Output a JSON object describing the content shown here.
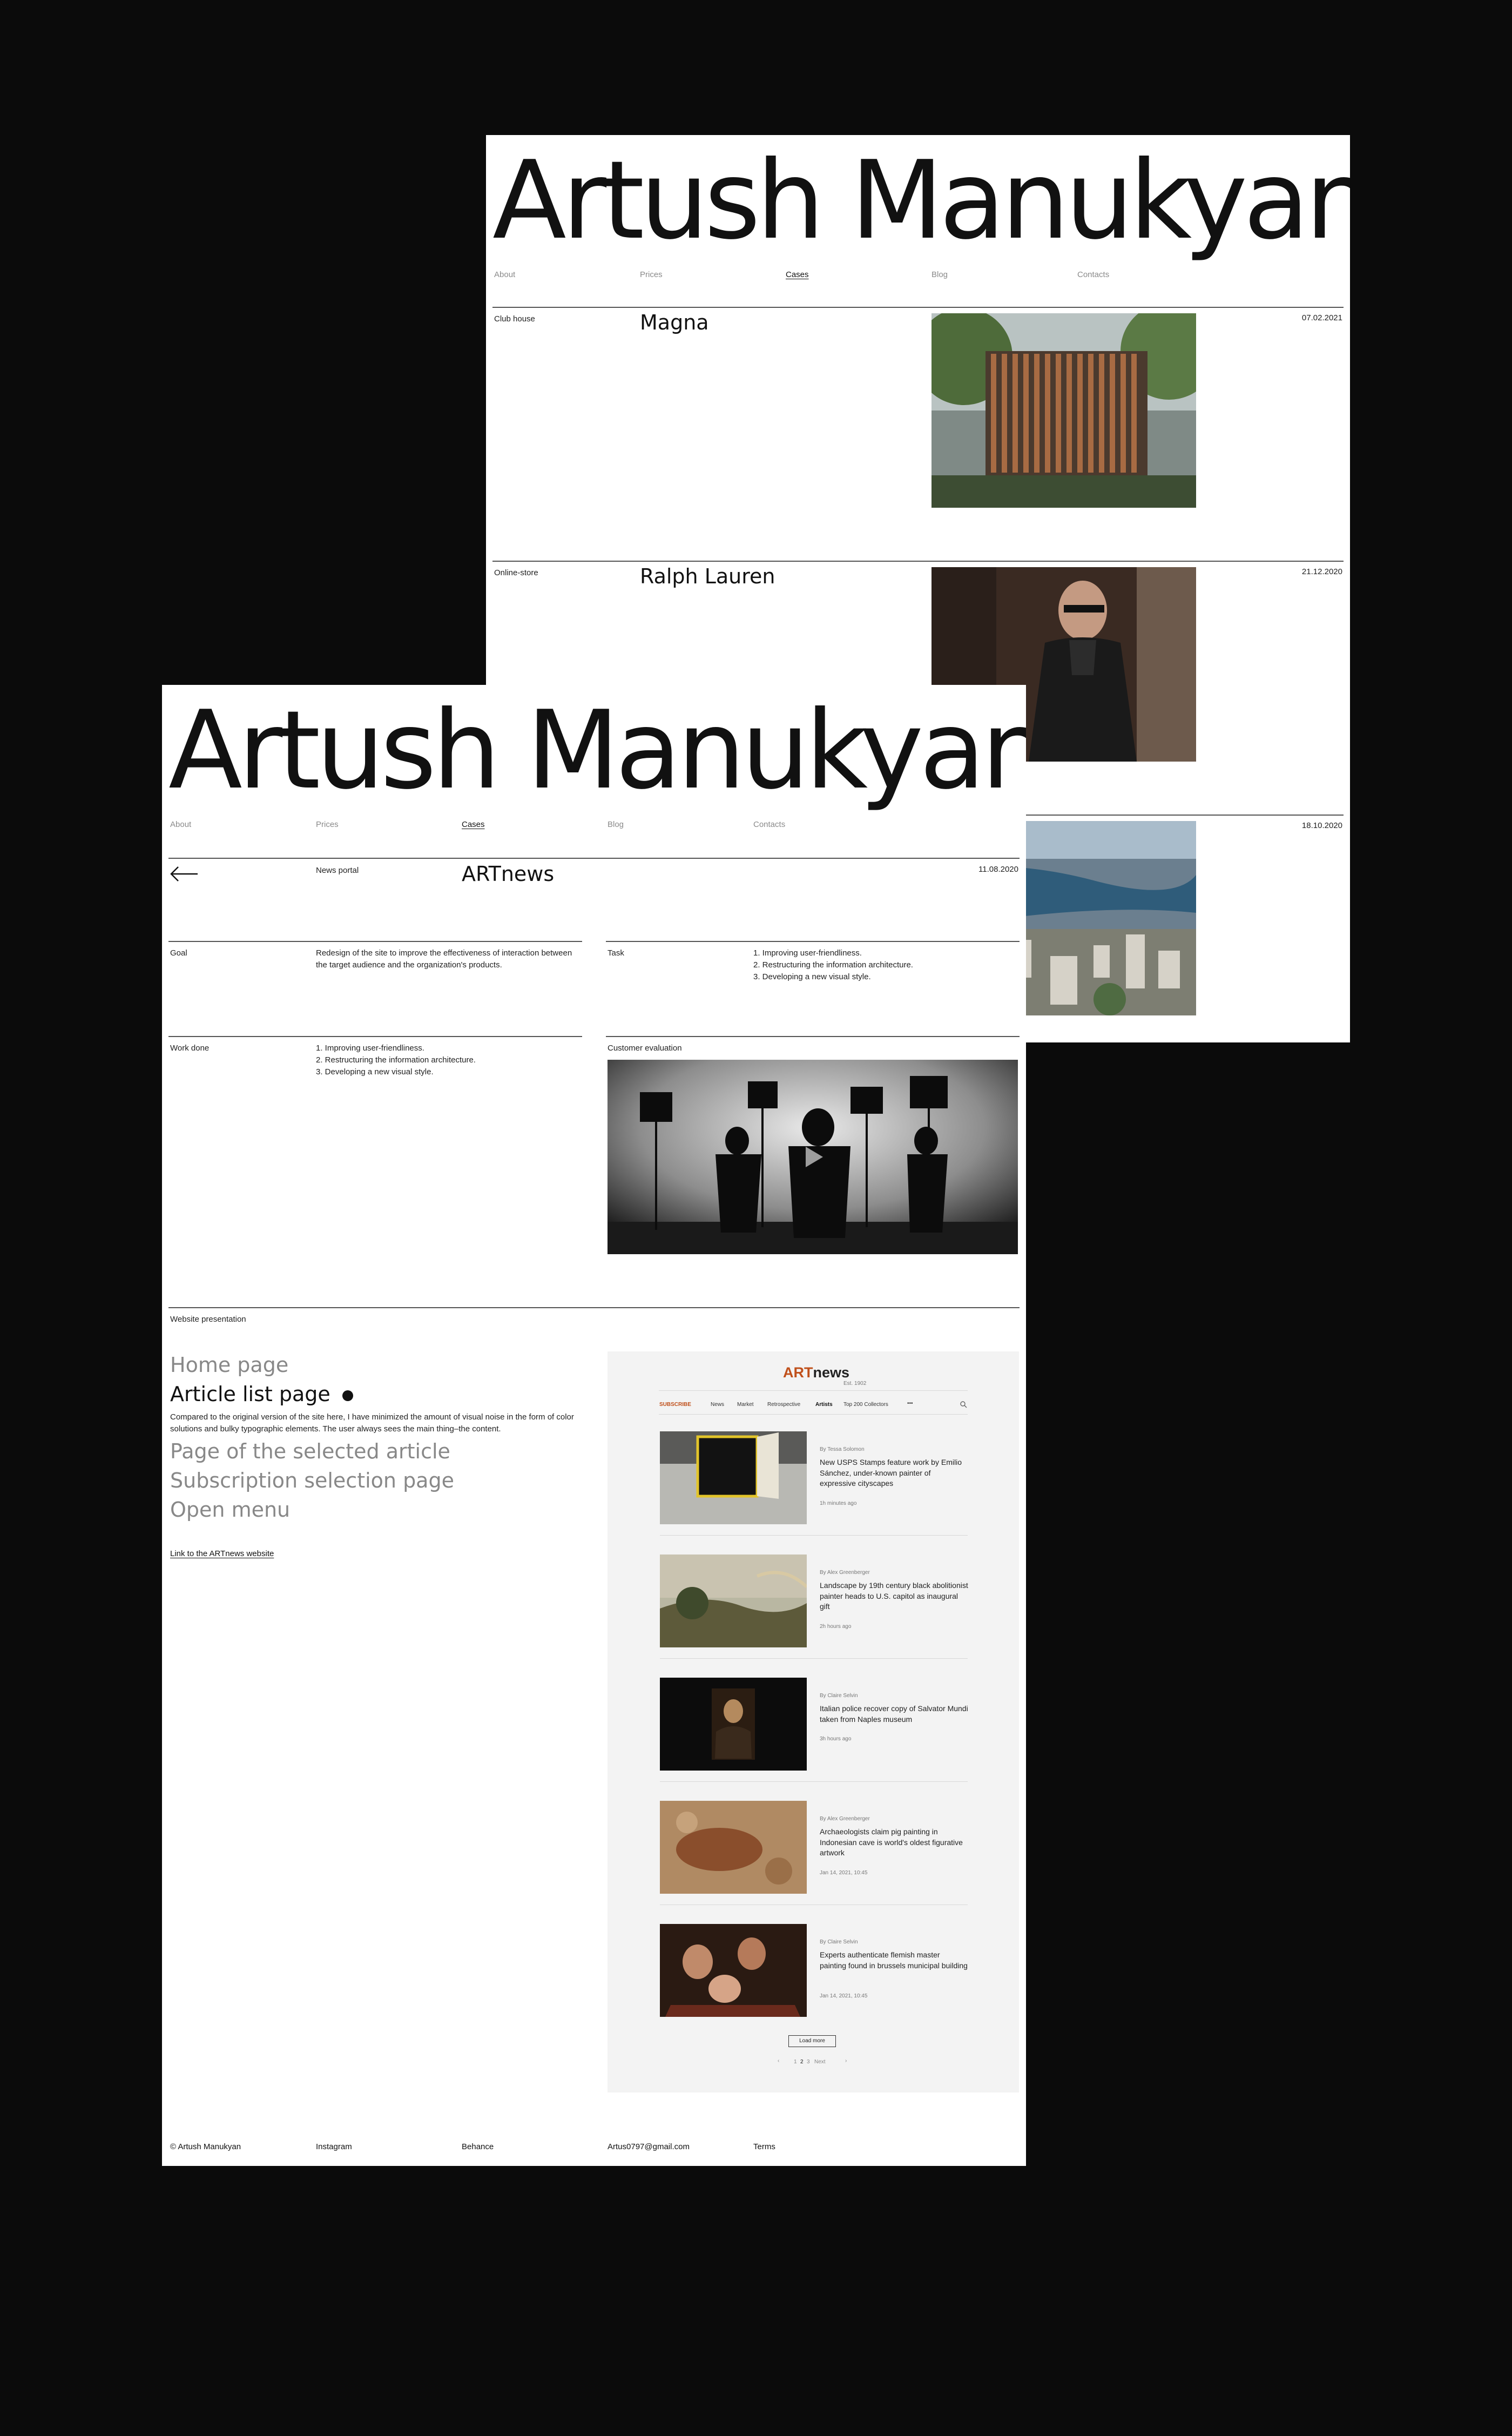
{
  "brand": "Artush Manukyan",
  "nav": [
    "About",
    "Prices",
    "Cases",
    "Blog",
    "Contacts"
  ],
  "back_panel": {
    "cases": [
      {
        "category": "Club house",
        "title": "Magna",
        "date": "07.02.2021",
        "image": "architecture-facade-photo"
      },
      {
        "category": "Online-store",
        "title": "Ralph Lauren",
        "date": "21.12.2020",
        "image": "fashion-model-photo"
      },
      {
        "category": "",
        "title": "",
        "date": "18.10.2020",
        "image": "aerial-city-photo"
      }
    ]
  },
  "front_panel": {
    "back_icon": "arrow-left-icon",
    "category": "News portal",
    "title": "ARTnews",
    "date": "11.08.2020",
    "goal_label": "Goal",
    "goal_text": "Redesign of the site to improve the effectiveness of interaction between the target audience and the organization's products.",
    "task_label": "Task",
    "task_items": [
      "1. Improving user-friendliness.",
      "2. Restructuring the information architecture.",
      "3. Developing a new visual style."
    ],
    "work_label": "Work done",
    "work_items": [
      "1. Improving user-friendliness.",
      "2. Restructuring the information architecture.",
      "3. Developing a new visual style."
    ],
    "eval_label": "Customer evaluation",
    "video_icon": "play-icon",
    "presentation_label": "Website presentation",
    "pages": [
      {
        "label": "Home page",
        "active": false
      },
      {
        "label": "Article list page",
        "active": true
      },
      {
        "label": "Page of the selected article",
        "active": false
      },
      {
        "label": "Subscription selection page",
        "active": false
      },
      {
        "label": "Open menu",
        "active": false
      }
    ],
    "active_page_description": "Compared to the original version of the site here, I have minimized the amount of visual noise in the form of color solutions and bulky typographic elements. The user always sees the main thing–the content.",
    "site_link": "Link to the ARTnews website",
    "footer": [
      "© Artush Manukyan",
      "Instagram",
      "Behance",
      "Artus0797@gmail.com",
      "Terms"
    ]
  },
  "mock_site": {
    "logo_art": "ART",
    "logo_news": "news",
    "logo_sub": "Est. 1902",
    "subscribe": "SUBSCRIBE",
    "menu": [
      "News",
      "Market",
      "Retrospective",
      "Artists",
      "Top 200 Collectors"
    ],
    "more": "•••",
    "search_icon": "search-icon",
    "articles": [
      {
        "byline": "By Tessa Solomon",
        "title": "New USPS Stamps feature work by Emilio Sánchez, under-known painter of expressive cityscapes",
        "time": "1h minutes ago"
      },
      {
        "byline": "By Alex Greenberger",
        "title": "Landscape by 19th century black abolitionist painter heads to U.S. capitol as inaugural gift",
        "time": "2h hours ago"
      },
      {
        "byline": "By Claire Selvin",
        "title": "Italian police recover copy of Salvator Mundi taken from Naples museum",
        "time": "3h hours ago"
      },
      {
        "byline": "By Alex Greenberger",
        "title": "Archaeologists claim pig painting in Indonesian cave is world's oldest figurative artwork",
        "time": "Jan 14, 2021, 10:45"
      },
      {
        "byline": "By Claire Selvin",
        "title": "Experts authenticate flemish master painting found in brussels municipal building",
        "time": "Jan 14, 2021, 10:45"
      }
    ],
    "load_more": "Load more",
    "pagination": [
      "1",
      "2",
      "3",
      "Next"
    ]
  },
  "colors": {
    "background": "#0b0b0b",
    "panel": "#ffffff",
    "accent": "#c0501b",
    "text": "#111111"
  }
}
